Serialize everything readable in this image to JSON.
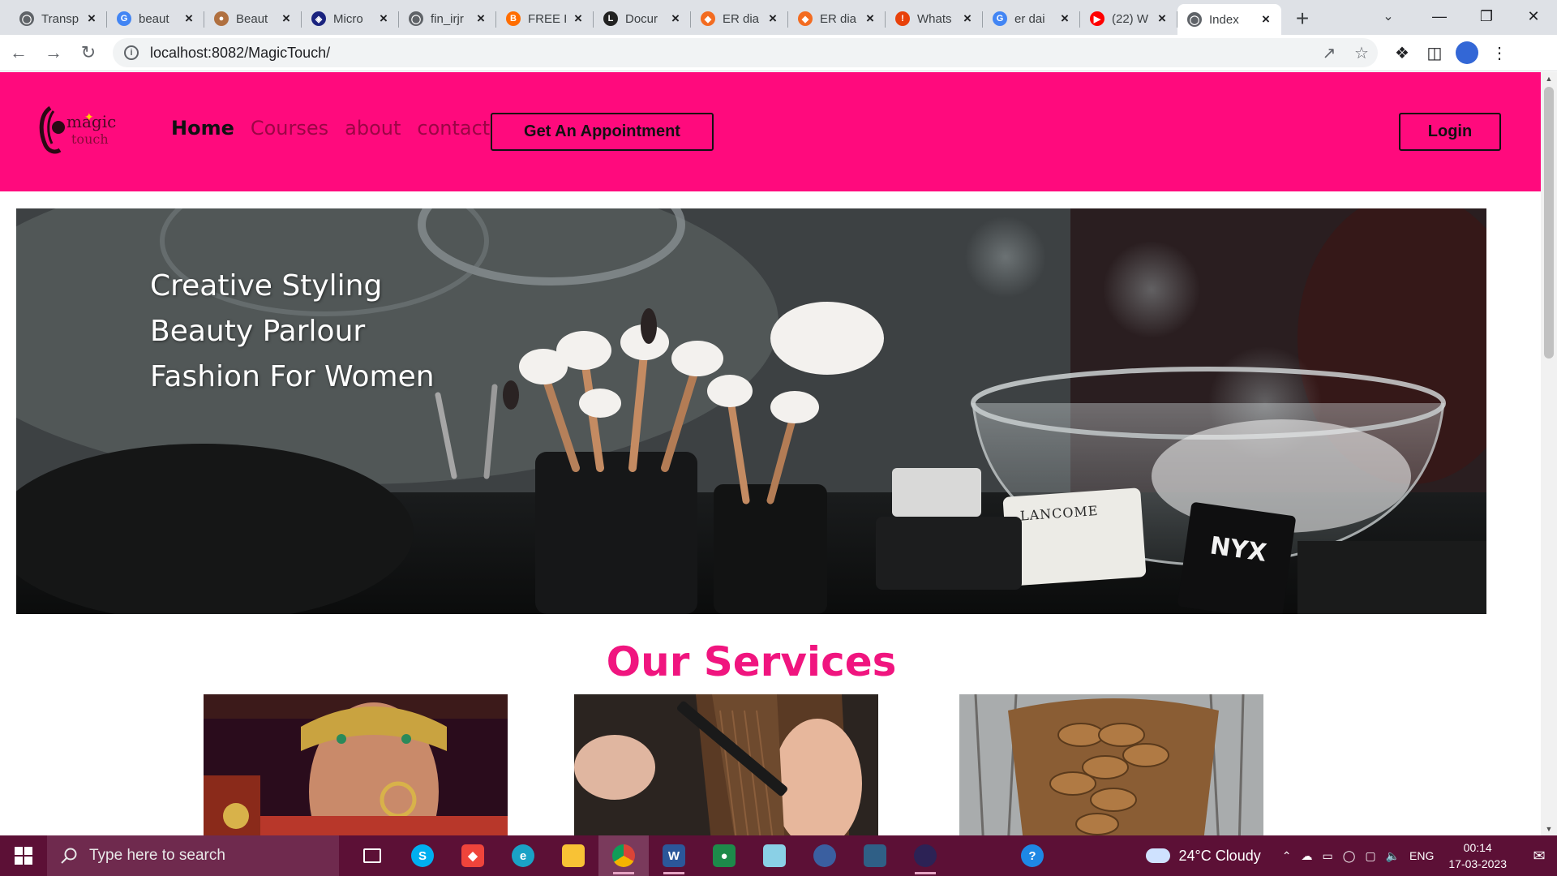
{
  "browser": {
    "tabs": [
      {
        "title": "Transp",
        "icon": "globe-icon",
        "color": "#5f6368"
      },
      {
        "title": "beaut",
        "icon": "google-icon",
        "color": "#4285f4"
      },
      {
        "title": "Beaut",
        "icon": "site-favicon",
        "color": "#b07040"
      },
      {
        "title": "Micro",
        "icon": "shield-favicon",
        "color": "#1a237e"
      },
      {
        "title": "fin_irjr",
        "icon": "globe-icon",
        "color": "#5f6368"
      },
      {
        "title": "FREE I",
        "icon": "blogger-icon",
        "color": "#ff6d00"
      },
      {
        "title": "Docur",
        "icon": "doc-icon",
        "color": "#222222"
      },
      {
        "title": "ER dia",
        "icon": "lucid-icon",
        "color": "#f36c21"
      },
      {
        "title": "ER dia",
        "icon": "lucid-icon",
        "color": "#f36c21"
      },
      {
        "title": "Whats",
        "icon": "alert-icon",
        "color": "#e8410a"
      },
      {
        "title": "er dai",
        "icon": "google-icon",
        "color": "#4285f4"
      },
      {
        "title": "(22) W",
        "icon": "youtube-icon",
        "color": "#ff0000"
      },
      {
        "title": "Index",
        "icon": "globe-icon",
        "color": "#5f6368"
      }
    ],
    "url": "localhost:8082/MagicTouch/"
  },
  "site": {
    "brand_color": "#ff0a7d",
    "nav": {
      "home": "Home",
      "courses": "Courses",
      "about": "about",
      "contact": "contact"
    },
    "appointment_button": "Get An Appointment",
    "login_button": "Login",
    "hero": {
      "line1": "Creative Styling",
      "line2": "Beauty Parlour",
      "line3": "Fashion For Women",
      "brand_label": "LANCOME",
      "brand_label2": "NYX"
    },
    "services_title": "Our Services"
  },
  "taskbar": {
    "search_placeholder": "Type here to search",
    "weather": "24°C  Cloudy",
    "language": "ENG",
    "time": "00:14",
    "date": "17-03-2023"
  }
}
